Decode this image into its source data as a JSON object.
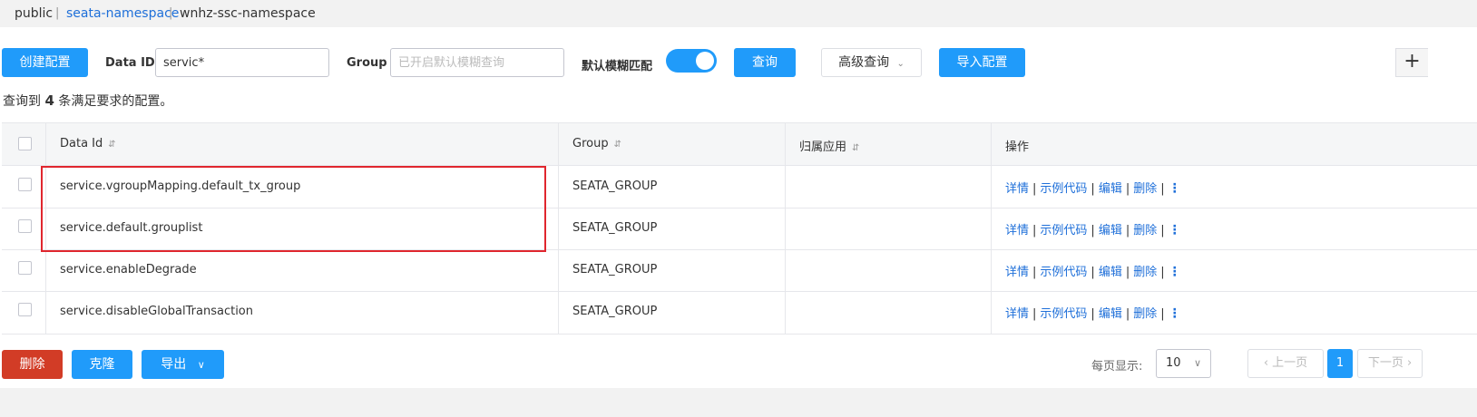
{
  "namespaces": {
    "items": [
      {
        "label": "public"
      },
      {
        "label": "seata-namespace"
      },
      {
        "label": "wnhz-ssc-namespace"
      }
    ],
    "separator": "|",
    "active_color": "#1e6fd9"
  },
  "toolbar": {
    "create_label": "创建配置",
    "dataid_label": "Data ID",
    "dataid_value": "servic*",
    "group_label": "Group",
    "group_placeholder": "已开启默认模糊查询",
    "fuzzy_label": "默认模糊匹配",
    "fuzzy_on": true,
    "query_label": "查询",
    "advanced_label": "高级查询",
    "import_label": "导入配置",
    "plus_label": "+"
  },
  "summary": {
    "prefix": "查询到",
    "count": "4",
    "suffix": "条满足要求的配置。"
  },
  "table": {
    "columns": [
      "Data Id",
      "Group",
      "归属应用",
      "操作"
    ],
    "sort_icon": "⇵",
    "rows": [
      {
        "data_id": "service.vgroupMapping.default_tx_group",
        "group": "SEATA_GROUP",
        "app": ""
      },
      {
        "data_id": "service.default.grouplist",
        "group": "SEATA_GROUP",
        "app": ""
      },
      {
        "data_id": "service.enableDegrade",
        "group": "SEATA_GROUP",
        "app": ""
      },
      {
        "data_id": "service.disableGlobalTransaction",
        "group": "SEATA_GROUP",
        "app": ""
      }
    ],
    "ops": {
      "detail": "详情",
      "sample": "示例代码",
      "edit": "编辑",
      "delete": "删除",
      "sep": "|",
      "more": "⋮"
    }
  },
  "footer": {
    "delete_label": "删除",
    "clone_label": "克隆",
    "export_label": "导出",
    "page_size_label": "每页显示:",
    "page_size": "10",
    "prev_label": "上一页",
    "current_page": "1",
    "next_label": "下一页"
  },
  "colors": {
    "primary": "#209bfa",
    "danger": "#d23c26",
    "highlight_box": "#e0262e",
    "link": "#1e6fd9"
  }
}
